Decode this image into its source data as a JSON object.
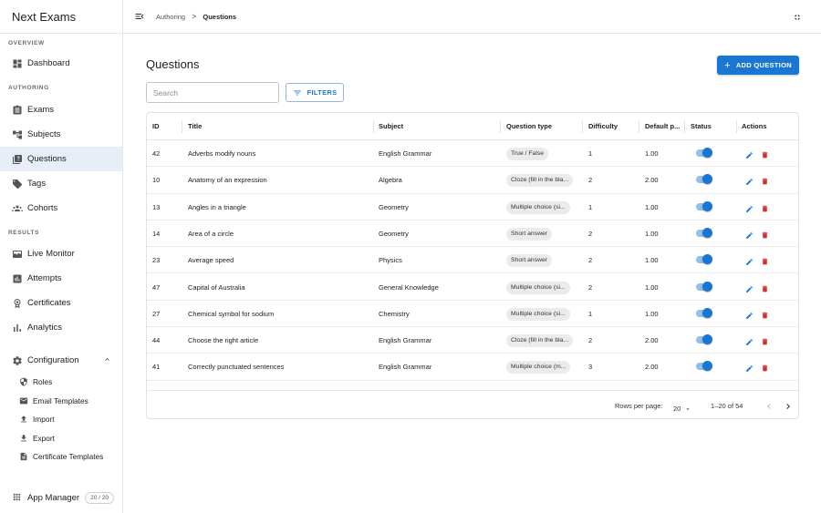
{
  "app": {
    "title": "Next Exams"
  },
  "sidebar": {
    "overview_title": "OVERVIEW",
    "overview_items": [
      {
        "label": "Dashboard",
        "icon": "dashboard-icon"
      }
    ],
    "authoring_title": "AUTHORING",
    "authoring_items": [
      {
        "label": "Exams",
        "icon": "assignment-icon"
      },
      {
        "label": "Subjects",
        "icon": "hierarchy-icon"
      },
      {
        "label": "Questions",
        "icon": "quiz-icon",
        "active": true
      },
      {
        "label": "Tags",
        "icon": "tag-icon"
      },
      {
        "label": "Cohorts",
        "icon": "groups-icon"
      }
    ],
    "results_title": "RESULTS",
    "results_items": [
      {
        "label": "Live Monitor",
        "icon": "monitor-heart-icon"
      },
      {
        "label": "Attempts",
        "icon": "bar-chart-icon"
      },
      {
        "label": "Certificates",
        "icon": "badge-icon"
      },
      {
        "label": "Analytics",
        "icon": "analytics-icon"
      }
    ],
    "configuration": {
      "label": "Configuration",
      "expanded": true,
      "items": [
        {
          "label": "Roles",
          "icon": "shield-icon"
        },
        {
          "label": "Email Templates",
          "icon": "email-icon"
        },
        {
          "label": "Import",
          "icon": "upload-icon"
        },
        {
          "label": "Export",
          "icon": "download-icon"
        },
        {
          "label": "Certificate Templates",
          "icon": "document-icon"
        }
      ]
    },
    "app_manager": {
      "label": "App Manager",
      "badge": "20 / 20"
    }
  },
  "topbar": {
    "breadcrumb_parent": "Authoring",
    "breadcrumb_separator": ">",
    "breadcrumb_current": "Questions"
  },
  "main": {
    "title": "Questions",
    "add_button_label": "ADD QUESTION",
    "search_placeholder": "Search",
    "filters_label": "FILTERS"
  },
  "table": {
    "columns": [
      "ID",
      "Title",
      "Subject",
      "Question type",
      "Difficulty",
      "Default p...",
      "Status",
      "Actions"
    ],
    "rows": [
      {
        "id": "42",
        "title": "Adverbs modify nouns",
        "subject": "English Grammar",
        "type": "True / False",
        "difficulty": "1",
        "points": "1.00",
        "active": true
      },
      {
        "id": "10",
        "title": "Anatomy of an expression",
        "subject": "Algebra",
        "type": "Cloze (fill in the bla...",
        "difficulty": "2",
        "points": "2.00",
        "active": true
      },
      {
        "id": "13",
        "title": "Angles in a triangle",
        "subject": "Geometry",
        "type": "Multiple choice (si...",
        "difficulty": "1",
        "points": "1.00",
        "active": true
      },
      {
        "id": "14",
        "title": "Area of a circle",
        "subject": "Geometry",
        "type": "Short answer",
        "difficulty": "2",
        "points": "1.00",
        "active": true
      },
      {
        "id": "23",
        "title": "Average speed",
        "subject": "Physics",
        "type": "Short answer",
        "difficulty": "2",
        "points": "1.00",
        "active": true
      },
      {
        "id": "47",
        "title": "Capital of Australia",
        "subject": "General Knowledge",
        "type": "Multiple choice (si...",
        "difficulty": "2",
        "points": "1.00",
        "active": true
      },
      {
        "id": "27",
        "title": "Chemical symbol for sodium",
        "subject": "Chemistry",
        "type": "Multiple choice (si...",
        "difficulty": "1",
        "points": "1.00",
        "active": true
      },
      {
        "id": "44",
        "title": "Choose the right article",
        "subject": "English Grammar",
        "type": "Cloze (fill in the bla...",
        "difficulty": "2",
        "points": "2.00",
        "active": true
      },
      {
        "id": "41",
        "title": "Correctly punctuated sentences",
        "subject": "English Grammar",
        "type": "Multiple choice (m...",
        "difficulty": "3",
        "points": "2.00",
        "active": true
      }
    ],
    "footer": {
      "rows_per_page_label": "Rows per page:",
      "rows_per_page_value": "20",
      "range_label": "1–20 of 54"
    }
  },
  "colors": {
    "accent": "#1976d2",
    "delete": "#d32f2f",
    "active_nav_bg": "#e8eef8",
    "toggle_track": "#90bdea"
  }
}
